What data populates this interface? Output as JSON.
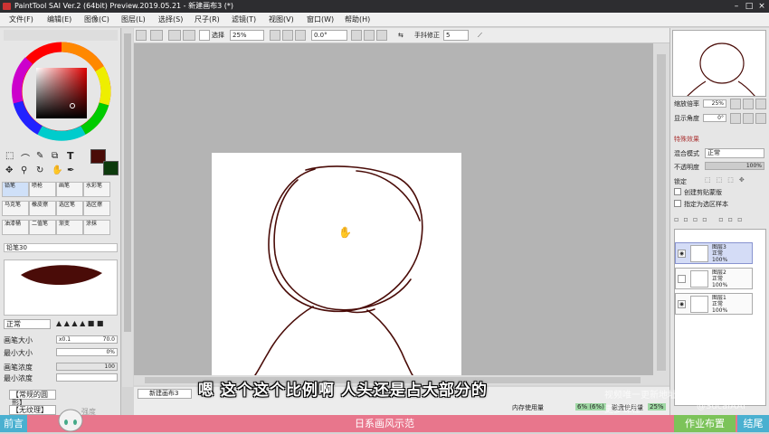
{
  "window": {
    "title": "PaintTool SAI Ver.2 (64bit) Preview.2019.05.21 - 新建画布3 (*)"
  },
  "menu": [
    "文件(F)",
    "编辑(E)",
    "图像(C)",
    "图层(L)",
    "选择(S)",
    "尺子(R)",
    "滤镜(T)",
    "视图(V)",
    "窗口(W)",
    "帮助(H)"
  ],
  "toolbar": {
    "select_label": "选择",
    "zoom": "25%",
    "angle": "0.0°",
    "stabilizer_label": "手抖修正",
    "stabilizer_value": "5"
  },
  "brush_panel": {
    "tools": [
      "铅笔",
      "喷枪",
      "画笔",
      "水彩笔",
      "马克笔",
      "橡皮擦",
      "选区笔",
      "选区擦",
      "油漆桶",
      "二值笔",
      "渐变",
      "涂抹"
    ],
    "current": "铅笔30",
    "blend": "正常",
    "size_label": "画笔大小",
    "size_mult": "x0.1",
    "size_value": "70.0",
    "min_size_label": "最小大小",
    "min_size_value": "0%",
    "density_label": "画笔浓度",
    "density_value": "100",
    "min_density_label": "最小浓度",
    "shape_label": "【常规的圆形】",
    "texture_label": "【无纹理】",
    "texture_strength": "强度",
    "other_label": "其他"
  },
  "navigator": {
    "zoom_label": "缩放倍率",
    "zoom_value": "25%",
    "angle_label": "显示角度",
    "angle_value": "0°"
  },
  "layer_panel": {
    "effects_label": "特殊效果",
    "blend_label": "混合模式",
    "blend_value": "正常",
    "opacity_label": "不透明度",
    "opacity_value": "100%",
    "lock_label": "锁定",
    "clip_label": "创建剪贴蒙版",
    "sample_label": "指定为选区样本",
    "layers": [
      {
        "name": "图层3",
        "mode": "正常",
        "opacity": "100%"
      },
      {
        "name": "图层2",
        "mode": "正常",
        "opacity": "100%"
      },
      {
        "name": "图层1",
        "mode": "正常",
        "opacity": "100%"
      }
    ]
  },
  "status": {
    "tab": "新建画布3",
    "memory_label": "内存使用量",
    "memory_value": "6% (6%)",
    "disk_label": "磁盘使用量",
    "disk_value": "25%"
  },
  "subtitle": "嗯 这个这个比例啊 人头还是占大部分的",
  "bottom": {
    "left": "前言",
    "middle": "日系画风示范",
    "right1": "作业布置",
    "right2": "结尾"
  },
  "watermarks": [
    "视频唯一更新地址",
    "更多课程",
    "@SucaiAAI"
  ],
  "colors": {
    "primary": "#4a0c08",
    "secondary": "#0d3a0d",
    "stroke": "#4a0c08"
  }
}
